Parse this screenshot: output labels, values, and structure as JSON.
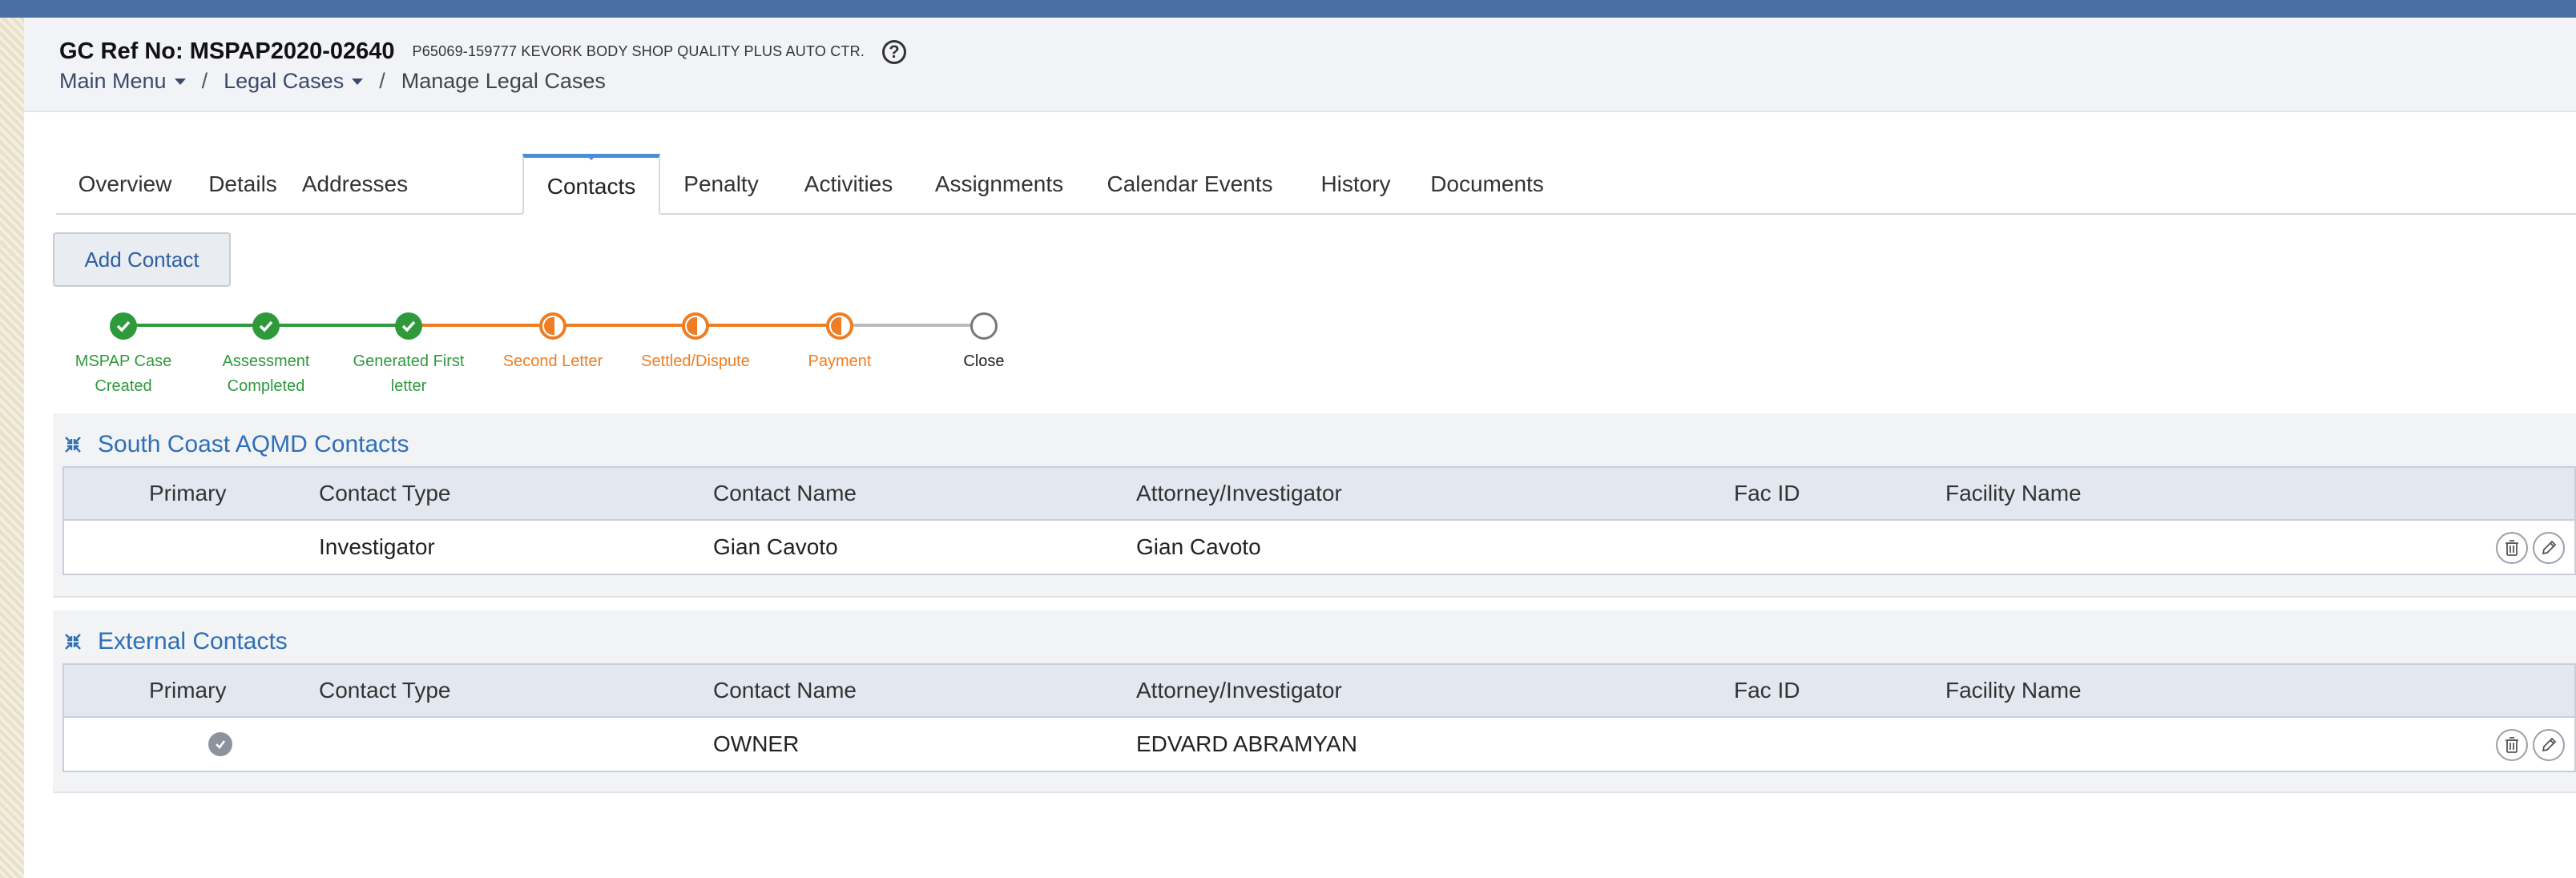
{
  "header": {
    "title": "GC Ref No: MSPAP2020-02640",
    "subtitle": "P65069-159777 KEVORK BODY SHOP QUALITY PLUS AUTO CTR.",
    "help_glyph": "?",
    "breadcrumb": {
      "main_menu": "Main Menu",
      "legal_cases": "Legal Cases",
      "separator": "/",
      "current": "Manage Legal Cases"
    }
  },
  "tabs": [
    {
      "label": "Overview"
    },
    {
      "label": "Details"
    },
    {
      "label": "Addresses"
    },
    {
      "label": "Contacts",
      "active": true
    },
    {
      "label": "Penalty"
    },
    {
      "label": "Activities"
    },
    {
      "label": "Assignments"
    },
    {
      "label": "Calendar Events"
    },
    {
      "label": "History"
    },
    {
      "label": "Documents"
    }
  ],
  "add_contact_label": "Add Contact",
  "workflow": {
    "steps": [
      {
        "line1": "MSPAP Case",
        "line2": "Created",
        "status": "done"
      },
      {
        "line1": "Assessment",
        "line2": "Completed",
        "status": "done"
      },
      {
        "line1": "Generated First",
        "line2": "letter",
        "status": "done"
      },
      {
        "line1": "Second Letter",
        "line2": "",
        "status": "partial"
      },
      {
        "line1": "Settled/Dispute",
        "line2": "",
        "status": "partial"
      },
      {
        "line1": "Payment",
        "line2": "",
        "status": "partial"
      },
      {
        "line1": "Close",
        "line2": "",
        "status": "pending"
      }
    ]
  },
  "columns": [
    "Primary",
    "Contact Type",
    "Contact Name",
    "Attorney/Investigator",
    "Fac ID",
    "Facility Name"
  ],
  "sections": {
    "aqmd": {
      "title": "South Coast AQMD Contacts",
      "rows": [
        {
          "primary": false,
          "contact_type": "Investigator",
          "contact_name": "Gian Cavoto",
          "attorney": "Gian Cavoto",
          "fac_id": "",
          "facility_name": ""
        }
      ]
    },
    "external": {
      "title": "External Contacts",
      "rows": [
        {
          "primary": true,
          "contact_type": "",
          "contact_name": "OWNER",
          "attorney": "EDVARD ABRAMYAN",
          "fac_id": "",
          "facility_name": ""
        }
      ]
    }
  },
  "colors": {
    "done": "#2f9a3c",
    "partial": "#ef7d22",
    "pending": "#777777",
    "link": "#2e6fb7",
    "tab_accent": "#4a8ed8"
  },
  "icons": {
    "help": "help-icon",
    "collapse": "collapse-icon",
    "delete": "trash-icon",
    "edit": "pencil-icon",
    "primary": "check-icon"
  }
}
